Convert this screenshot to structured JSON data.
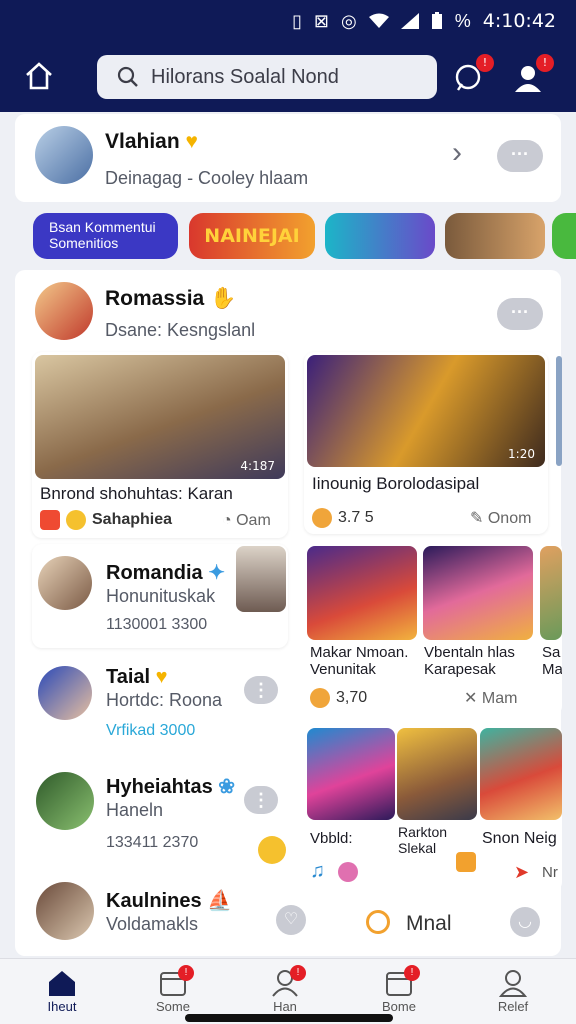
{
  "status_bar": {
    "time": "4:10:42",
    "battery_text": "%"
  },
  "header": {
    "search_text": "Hilorans Soalal Nond",
    "badges": {
      "chat": "!",
      "profile": "!"
    }
  },
  "top_profile": {
    "name": "Vlahian",
    "subtitle": "Deinagag - Cooley hlaam",
    "more": "···",
    "chevron": "›"
  },
  "chips": [
    {
      "label": "Bsan Kommentui Somenitios"
    },
    {
      "label": "NAINEJAI"
    },
    {
      "label": ""
    },
    {
      "label": ""
    }
  ],
  "feed_header": {
    "name": "Romassia",
    "subtitle": "Dsane: Kesngslanl",
    "more": "···"
  },
  "post_left": {
    "duration": "4:187",
    "caption": "Bnrond shohuhtas: Karan",
    "author": "Sahaphiea",
    "meta": "Oam"
  },
  "post_right": {
    "duration": "1:20",
    "caption": "Iinounig Borolodasipal",
    "count": "3.7 5",
    "meta": "Onom"
  },
  "people": [
    {
      "name": "Romandia",
      "line1": "Honunituskak",
      "line2": "1130001 3300"
    },
    {
      "name": "Taial",
      "line1": "Hortdc: Roona",
      "line2": "Vrfikad 3000"
    },
    {
      "name": "Hyheiahtas",
      "line1": "Haneln",
      "line2": "133411 2370"
    },
    {
      "name": "Kaulnines",
      "line1": "Voldamakls",
      "line2": ""
    }
  ],
  "grid_mid": {
    "caption_left": "Makar Nmoan. Venunitak",
    "caption_right": "Vbentaln hlas Karapesak",
    "caption_edge": "Sa Ma",
    "count": "3,70",
    "meta": "Mam"
  },
  "grid_bottom": {
    "label_a": "Vbbld:",
    "label_b": "Rarkton Slekal",
    "label_c": "Snon Neig",
    "edge": "Nr"
  },
  "floating_bar": {
    "label": "Mnal"
  },
  "nav": [
    {
      "label": "Iheut",
      "badge": ""
    },
    {
      "label": "Some",
      "badge": "!"
    },
    {
      "label": "Han",
      "badge": "!"
    },
    {
      "label": "Bome",
      "badge": "!"
    },
    {
      "label": "Relef",
      "badge": ""
    }
  ],
  "colors": {
    "header_bg": "#0f1a57",
    "accent": "#3b38c4",
    "badge": "#e41e26"
  }
}
